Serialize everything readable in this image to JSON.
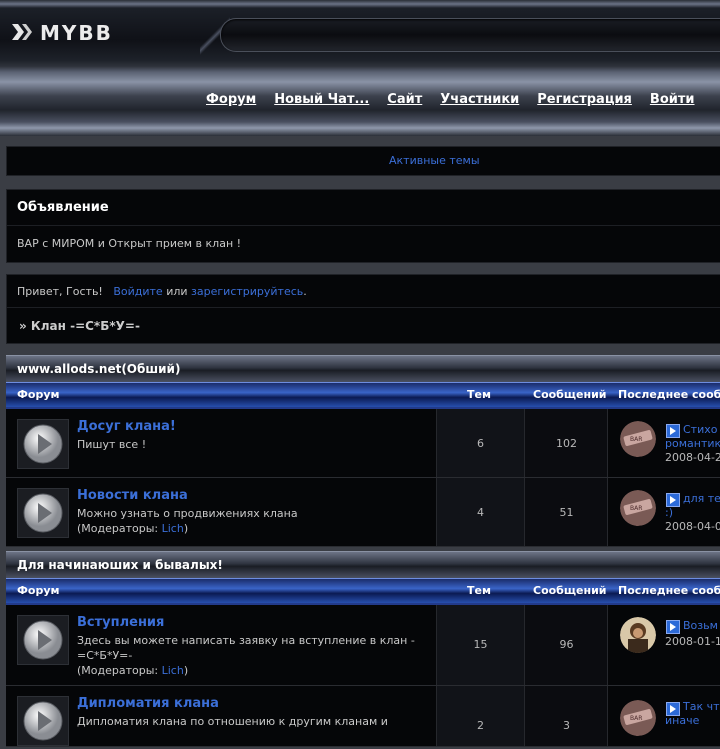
{
  "header": {
    "logo_text": "MYBB"
  },
  "nav": {
    "items": [
      "Форум",
      "Новый Чат...",
      "Сайт",
      "Участники",
      "Регистрация",
      "Войти"
    ]
  },
  "active_topics": "Активные темы",
  "announcement": {
    "title": "Объявление",
    "text": "ВАР с МИРОМ и Открыт прием в клан !"
  },
  "welcome": {
    "greeting": "Привет, Гость!",
    "login_link": "Войдите",
    "or": "или",
    "register_link": "зарегистрируйтесь",
    "dot": ".",
    "breadcrumb": "» Клан -=С*Б*У=-"
  },
  "columns": {
    "forum": "Форум",
    "topics": "Тем",
    "posts": "Сообщений",
    "last_post": "Последнее сооб"
  },
  "categories": [
    {
      "title": "www.allods.net(Обший)",
      "forums": [
        {
          "name": "Досуг клана!",
          "desc": "Пишут все !",
          "mods_label": "",
          "mod": "",
          "topics": "6",
          "posts": "102",
          "last_title_1": "Стихо",
          "last_title_2": "романтик",
          "last_date": "2008-04-2"
        },
        {
          "name": "Новости клана",
          "desc": "Можно узнать о продвижениях клана",
          "mods_label": "(Модераторы: ",
          "mod": "Lich",
          "mods_close": ")",
          "topics": "4",
          "posts": "51",
          "last_title_1": "для те",
          "last_title_2": ":)",
          "last_date": "2008-04-0"
        }
      ]
    },
    {
      "title": "Для начинаюших и бывалых!",
      "forums": [
        {
          "name": "Вступления",
          "desc": "Здесь вы можете написать заявку на вступление в клан -=С*Б*У=-",
          "mods_label": "(Модераторы: ",
          "mod": "Lich",
          "mods_close": ")",
          "topics": "15",
          "posts": "96",
          "last_title_1": "Возьм",
          "last_title_2": "",
          "last_date": "2008-01-1"
        },
        {
          "name": "Дипломатия клана",
          "desc": "Дипломатия клана по отношению к другим кланам и",
          "mods_label": "",
          "mod": "",
          "topics": "2",
          "posts": "3",
          "last_title_1": "Так чт",
          "last_title_2": "иначе",
          "last_date": ""
        }
      ]
    }
  ]
}
